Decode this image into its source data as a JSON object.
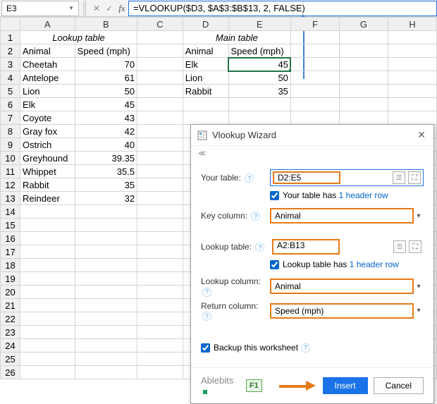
{
  "name_box": "E3",
  "formula": "=VLOOKUP($D3, $A$3:$B$13, 2, FALSE)",
  "columns": [
    "A",
    "B",
    "C",
    "D",
    "E",
    "F",
    "G",
    "H"
  ],
  "row_count": 26,
  "lookup_title": "Lookup table",
  "main_title": "Main table",
  "headers": {
    "animal": "Animal",
    "speed": "Speed (mph)"
  },
  "lookup_data": [
    {
      "a": "Cheetah",
      "s": "70"
    },
    {
      "a": "Antelope",
      "s": "61"
    },
    {
      "a": "Lion",
      "s": "50"
    },
    {
      "a": "Elk",
      "s": "45"
    },
    {
      "a": "Coyote",
      "s": "43"
    },
    {
      "a": "Gray fox",
      "s": "42"
    },
    {
      "a": "Ostrich",
      "s": "40"
    },
    {
      "a": "Greyhound",
      "s": "39.35"
    },
    {
      "a": "Whippet",
      "s": "35.5"
    },
    {
      "a": "Rabbit",
      "s": "35"
    },
    {
      "a": "Reindeer",
      "s": "32"
    }
  ],
  "main_data": [
    {
      "a": "Elk",
      "s": "45"
    },
    {
      "a": "Lion",
      "s": "50"
    },
    {
      "a": "Rabbit",
      "s": "35"
    }
  ],
  "dialog": {
    "title": "Vlookup Wizard",
    "your_table_label": "Your table:",
    "your_table_value": "D2:E5",
    "your_table_hdr_pre": "Your table has",
    "your_table_hdr_link": "1 header row",
    "key_col_label": "Key column:",
    "key_col_value": "Animal",
    "lookup_table_label": "Lookup table:",
    "lookup_table_value": "A2:B13",
    "lookup_table_hdr_pre": "Lookup table has",
    "lookup_table_hdr_link": "1 header row",
    "lookup_col_label": "Lookup column:",
    "lookup_col_value": "Animal",
    "return_col_label": "Return column:",
    "return_col_value": "Speed (mph)",
    "backup_label": "Backup this worksheet",
    "brand": "Ablebits",
    "f1": "F1",
    "insert": "Insert",
    "cancel": "Cancel"
  }
}
